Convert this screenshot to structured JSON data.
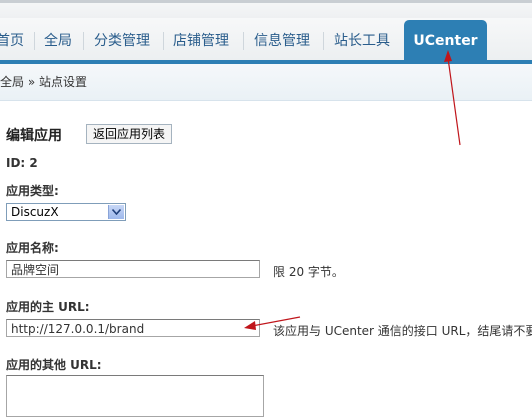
{
  "nav": {
    "items": [
      {
        "label": "首页"
      },
      {
        "label": "全局"
      },
      {
        "label": "分类管理"
      },
      {
        "label": "店铺管理"
      },
      {
        "label": "信息管理"
      },
      {
        "label": "站长工具"
      },
      {
        "label": "UCenter",
        "active": true
      }
    ],
    "active_color": "#2d7fb4",
    "link_color": "#2a5d8c"
  },
  "breadcrumb": {
    "text": "全局 » 站点设置"
  },
  "form": {
    "title": "编辑应用",
    "back_button": "返回应用列表",
    "id_text": "ID: 2",
    "app_type": {
      "label": "应用类型:",
      "selected": "DiscuzX"
    },
    "app_name": {
      "label": "应用名称:",
      "value": "品牌空间",
      "hint": "限 20 字节。"
    },
    "app_url": {
      "label": "应用的主 URL:",
      "value": "http://127.0.0.1/brand",
      "hint": "该应用与 UCenter 通信的接口 URL，结尾请不要"
    },
    "other_url": {
      "label": "应用的其他 URL:"
    }
  },
  "annotation": {
    "arrow_color": "#c0151b"
  }
}
